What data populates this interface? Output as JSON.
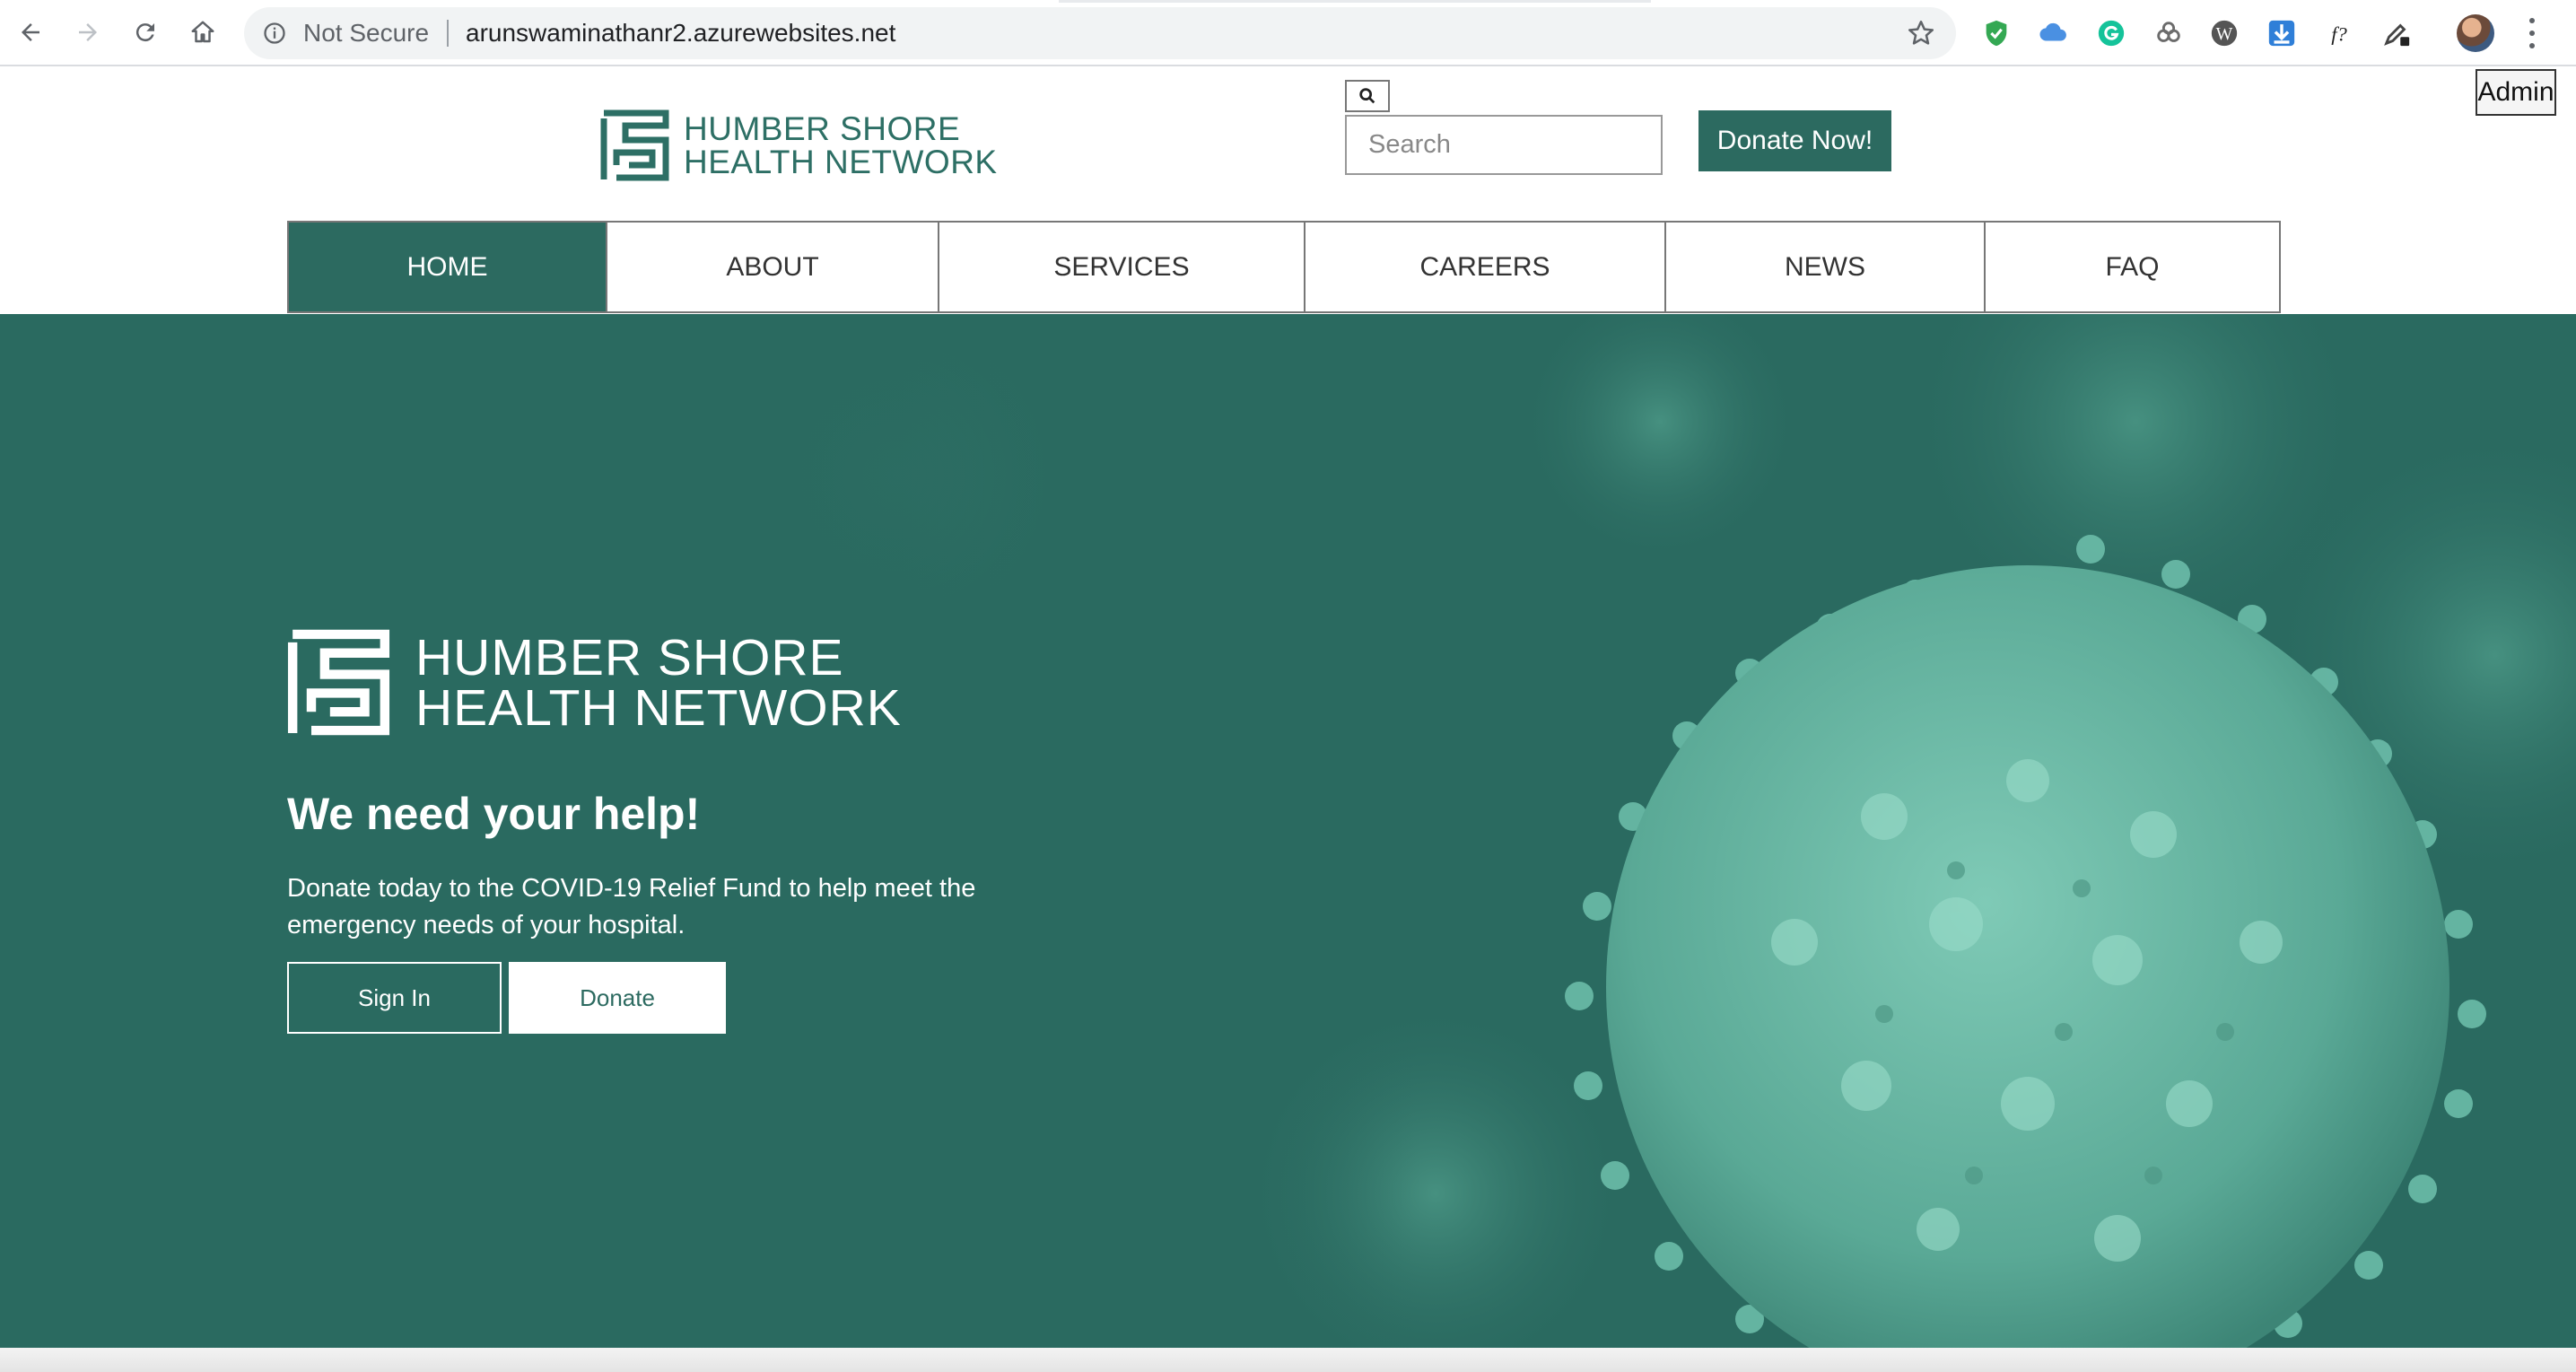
{
  "browser": {
    "status_text": "Not Secure",
    "url": "arunswaminathanr2.azurewebsites.net",
    "extensions": [
      "shield-icon",
      "cloud-icon",
      "grammarly-icon",
      "link-icon",
      "wordpress-icon",
      "download-icon",
      "font-icon",
      "eyedropper-icon"
    ]
  },
  "tooltip": {
    "label": "Admin"
  },
  "header": {
    "logo_line1": "HUMBER SHORE",
    "logo_line2": "HEALTH NETWORK",
    "search_placeholder": "Search",
    "donate_now_label": "Donate Now!"
  },
  "nav": {
    "items": [
      {
        "label": "HOME",
        "active": true
      },
      {
        "label": "ABOUT",
        "active": false
      },
      {
        "label": "SERVICES",
        "active": false
      },
      {
        "label": "CAREERS",
        "active": false
      },
      {
        "label": "NEWS",
        "active": false
      },
      {
        "label": "FAQ",
        "active": false
      }
    ]
  },
  "hero": {
    "logo_line1": "HUMBER SHORE",
    "logo_line2": "HEALTH NETWORK",
    "heading": "We need your help!",
    "body": "Donate today to the COVID-19 Relief Fund to help meet the emergency needs of your hospital.",
    "signin_label": "Sign In",
    "donate_label": "Donate"
  },
  "colors": {
    "brand": "#2c6a60",
    "hero_bg": "#2a6a60",
    "virus": "#6fc1ad"
  }
}
